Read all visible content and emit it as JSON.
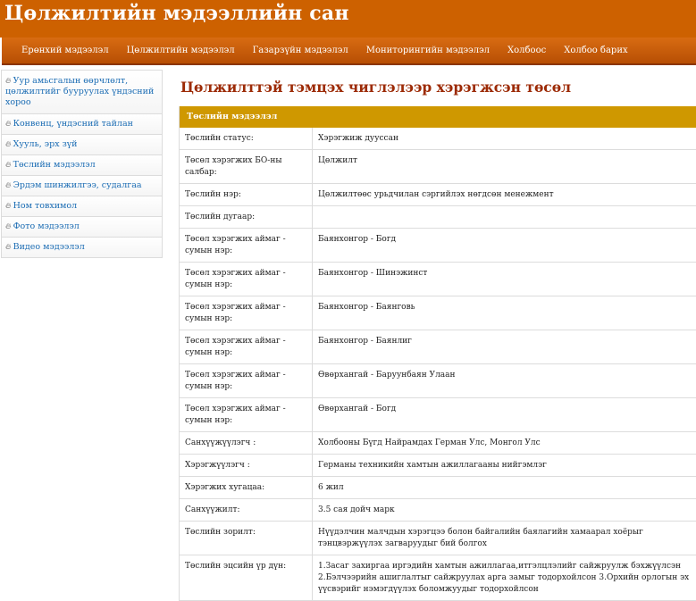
{
  "site": {
    "title": "Цөлжилтийн мэдээллийн сан"
  },
  "nav": {
    "items": [
      "Ерөнхий мэдээлэл",
      "Цөлжилтийн мэдээлэл",
      "Газарзүйн мэдээлэл",
      "Мониторингийн мэдээлэл",
      "Холбоос",
      "Холбоо барих"
    ]
  },
  "sidebar": {
    "icon": "flame-icon",
    "items": [
      "Уур амьсгалын өөрчлөлт, цөлжилтийг бууруулах үндэсний хороо",
      "Конвенц, үндэсний тайлан",
      "Хууль, эрх зүй",
      "Төслийн мэдээлэл",
      "Эрдэм шинжилгээ, судалгаа",
      "Ном товхимол",
      "Фото мэдээлэл",
      "Видео мэдээлэл"
    ]
  },
  "main": {
    "title": "Цөлжилттэй тэмцэх чиглэлээр хэрэгжсэн төсөл",
    "panel_header": "Төслийн мэдээлэл",
    "rows": [
      {
        "label": "Төслийн статус:",
        "value": "Хэрэгжиж дууссан"
      },
      {
        "label": "Төсөл хэрэгжих БО-ны салбар:",
        "value": "Цөлжилт"
      },
      {
        "label": "Төслийн нэр:",
        "value": "Цөлжилтөөс урьдчилан сэргийлэх нөгдсөн менежмент"
      },
      {
        "label": "Төслийн дугаар:",
        "value": ""
      },
      {
        "label": "Төсөл хэрэгжих аймаг - сумын нэр:",
        "value": "Баянхонгор - Богд"
      },
      {
        "label": "Төсөл хэрэгжих аймаг - сумын нэр:",
        "value": "Баянхонгор - Шинэжинст"
      },
      {
        "label": "Төсөл хэрэгжих аймаг - сумын нэр:",
        "value": "Баянхонгор - Баянговь"
      },
      {
        "label": "Төсөл хэрэгжих аймаг - сумын нэр:",
        "value": "Баянхонгор - Баянлиг"
      },
      {
        "label": "Төсөл хэрэгжих аймаг - сумын нэр:",
        "value": "Өвөрхангай - Баруунбаян Улаан"
      },
      {
        "label": "Төсөл хэрэгжих аймаг - сумын нэр:",
        "value": "Өвөрхангай - Богд"
      },
      {
        "label": "Санхүүжүүлэгч :",
        "value": "Холбооны Бүгд Найрамдах Герман Улс, Монгол Улс"
      },
      {
        "label": "Хэрэгжүүлэгч :",
        "value": "Германы техникийн хамтын ажиллагааны нийгэмлэг"
      },
      {
        "label": "Хэрэгжих хугацаа:",
        "value": "6 жил"
      },
      {
        "label": "Санхүүжилт:",
        "value": "3.5 сая дойч марк"
      },
      {
        "label": "Төслийн зорилт:",
        "value": "Нүүдэлчин малчдын хэрэгцээ болон байгалийн баялагийн хамаарал хоёрыг тэнцвэржүүлэх загваруудыг бий болгох"
      },
      {
        "label": "Төслийн эцсийн үр дүн:",
        "value": "1.Засаг захиргаа иргэдийн хамтын ажиллагаа,итгэлцлэлийг сайжруулж бэхжүүлсэн 2.Бэлчээрийн ашиглалтыг сайжруулах арга замыг тодорхойлсон 3.Орхийн орлогын эх үүсвэрийг нэмэгдүүлэх боломжуудыг тодорхойлсон"
      }
    ]
  }
}
